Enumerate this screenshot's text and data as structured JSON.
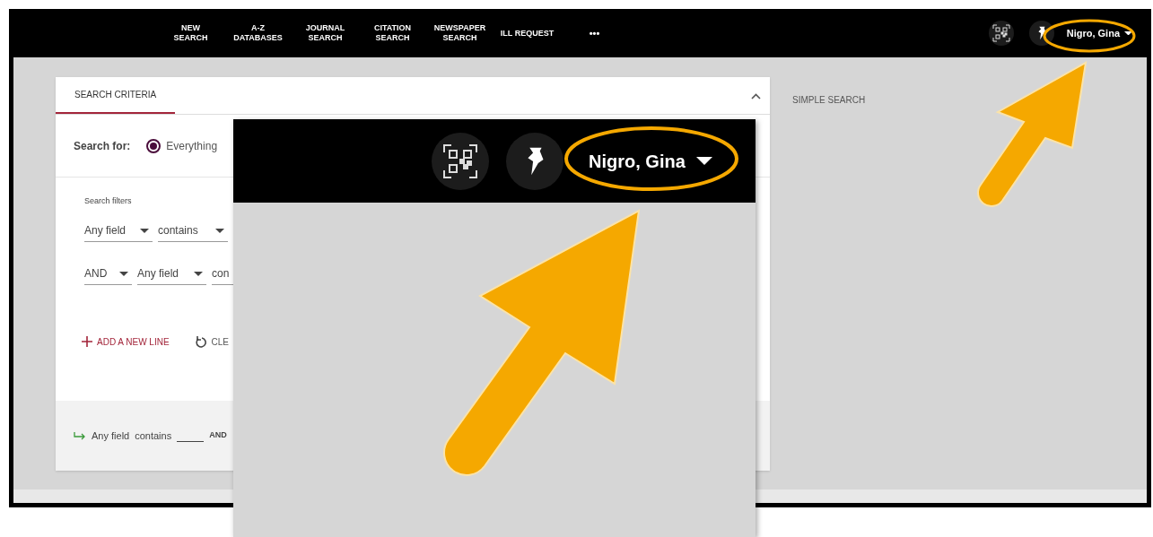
{
  "nav": {
    "items": [
      {
        "lines": [
          "NEW",
          "SEARCH"
        ]
      },
      {
        "lines": [
          "A-Z",
          "DATABASES"
        ]
      },
      {
        "lines": [
          "JOURNAL",
          "SEARCH"
        ]
      },
      {
        "lines": [
          "CITATION",
          "SEARCH"
        ]
      },
      {
        "lines": [
          "NEWSPAPER",
          "SEARCH"
        ]
      },
      {
        "lines": [
          "ILL REQUEST"
        ]
      }
    ],
    "more": "•••",
    "user_name": "Nigro, Gina"
  },
  "search_card": {
    "tabs": [
      {
        "label": "SEARCH CRITERIA",
        "selected": true
      }
    ],
    "search_for": {
      "label": "Search for:",
      "options": [
        {
          "label": "Everything",
          "selected": true
        }
      ]
    },
    "filters_label": "Search filters",
    "filter_rows": [
      [
        "Any field",
        "contains"
      ],
      [
        "AND",
        "Any field",
        "con"
      ]
    ],
    "actions": [
      {
        "kind": "add",
        "label": "ADD A NEW LINE"
      },
      {
        "kind": "clear",
        "label": "CLE"
      }
    ],
    "summary": [
      "Any field",
      "contains",
      "AND"
    ]
  },
  "simple_search": "SIMPLE SEARCH",
  "zoom_inset": {
    "user_name": "Nigro, Gina"
  }
}
